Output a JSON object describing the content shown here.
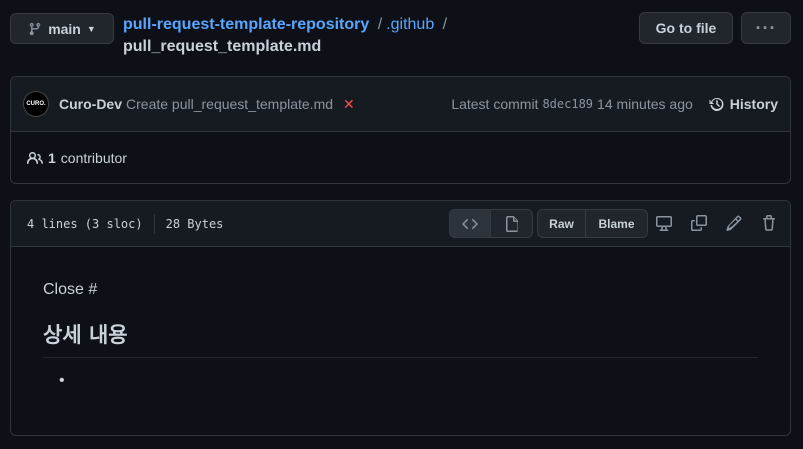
{
  "branch": {
    "name": "main"
  },
  "path": {
    "repo": "pull-request-template-repository",
    "sep1": "/",
    "dir": ".github",
    "sep2": "/",
    "file": "pull_request_template.md"
  },
  "toolbar": {
    "goto_label": "Go to file",
    "more_label": "···"
  },
  "commit": {
    "avatar_text": "CURO.",
    "author": "Curo-Dev",
    "message": "Create pull_request_template.md",
    "status_icon": "✕",
    "latest_label": "Latest commit",
    "sha": "8dec189",
    "time": "14 minutes ago",
    "history_label": "History"
  },
  "contributors": {
    "count": "1",
    "label": "contributor"
  },
  "file": {
    "lines": "4 lines (3 sloc)",
    "size": "28 Bytes",
    "raw_label": "Raw",
    "blame_label": "Blame"
  },
  "content": {
    "line1": "Close #",
    "heading": "상세 내용",
    "bullet": "•"
  },
  "colors": {
    "bg": "#0d1117",
    "link": "#58a6ff",
    "danger": "#f85149",
    "border": "#30363d"
  }
}
